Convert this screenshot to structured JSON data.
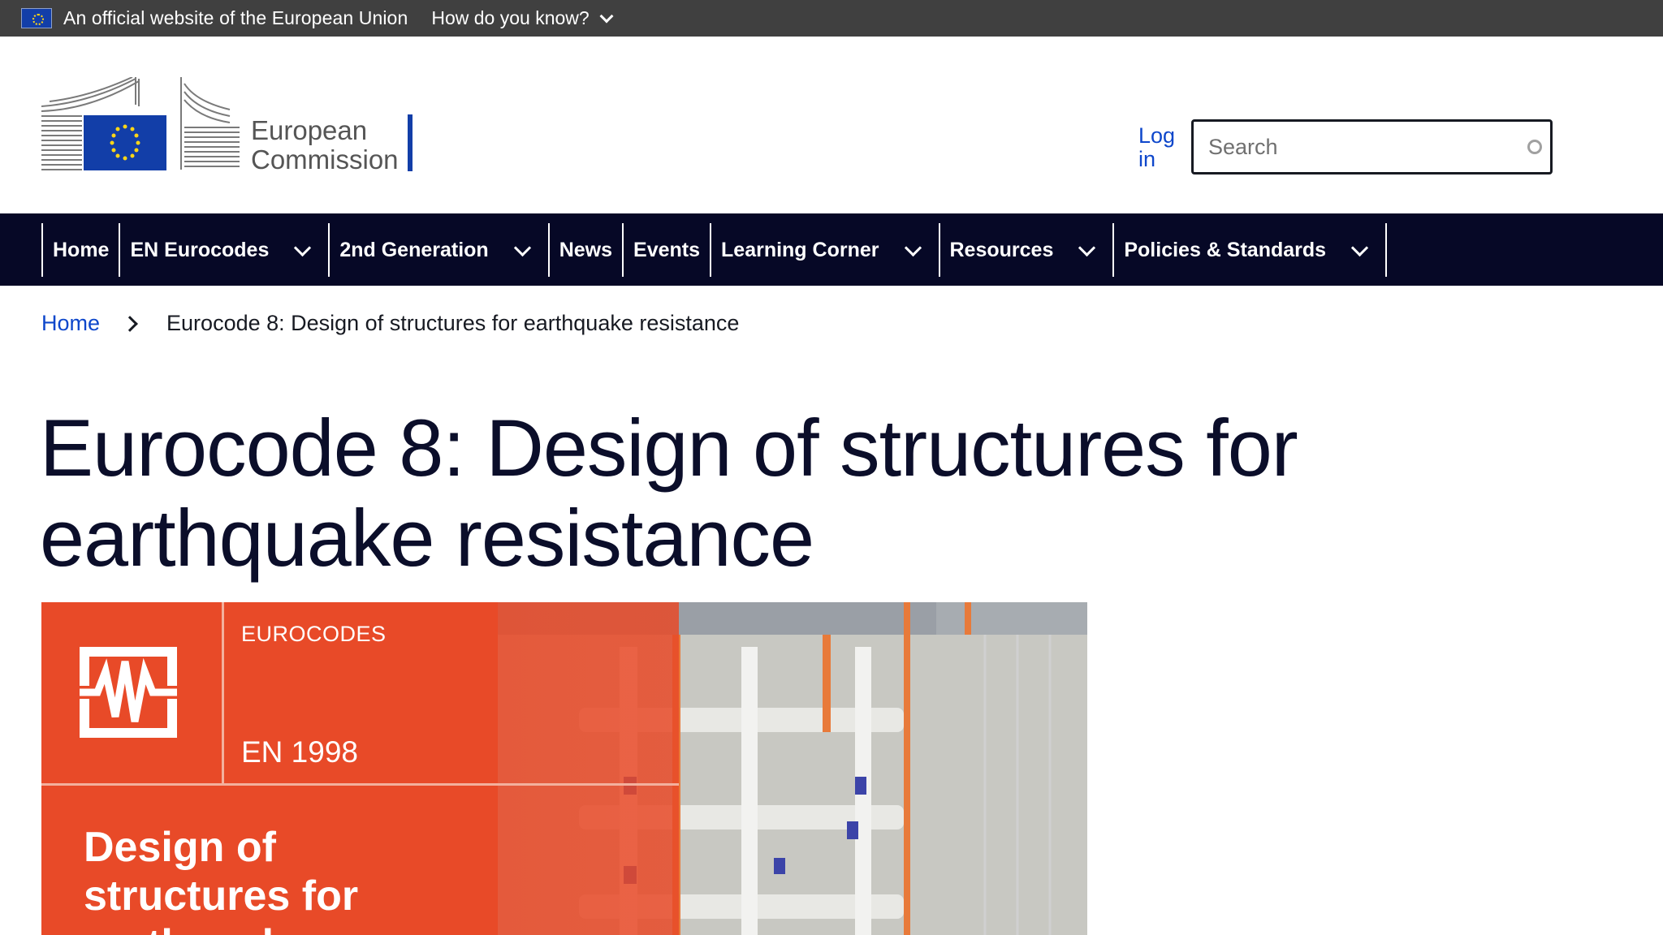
{
  "official_bar": {
    "text": "An official website of the European Union",
    "how_know": "How do you know?"
  },
  "header": {
    "logo_line1": "European",
    "logo_line2": "Commission",
    "login_line1": "Log",
    "login_line2": "in",
    "search_placeholder": "Search"
  },
  "nav": {
    "items": [
      {
        "label": "Home"
      },
      {
        "label": "EN Eurocodes"
      },
      {
        "label": "2nd Generation"
      },
      {
        "label": "News"
      },
      {
        "label": "Events"
      },
      {
        "label": "Learning Corner"
      },
      {
        "label": "Resources"
      },
      {
        "label": "Policies & Standards"
      }
    ]
  },
  "breadcrumb": {
    "home": "Home",
    "current": "Eurocode 8: Design of structures for earthquake resistance"
  },
  "page": {
    "title": "Eurocode 8: Design of structures for earthquake resistance"
  },
  "cover": {
    "label_top": "EUROCODES",
    "label_en": "EN 1998",
    "heading_line1": "Design of",
    "heading_line2": "structures for",
    "heading_line3": "earthquake"
  },
  "colors": {
    "nav_bg": "#060826",
    "link_blue": "#0e47cb",
    "cover_orange": "#e84a28",
    "official_bar_bg": "#404040"
  }
}
